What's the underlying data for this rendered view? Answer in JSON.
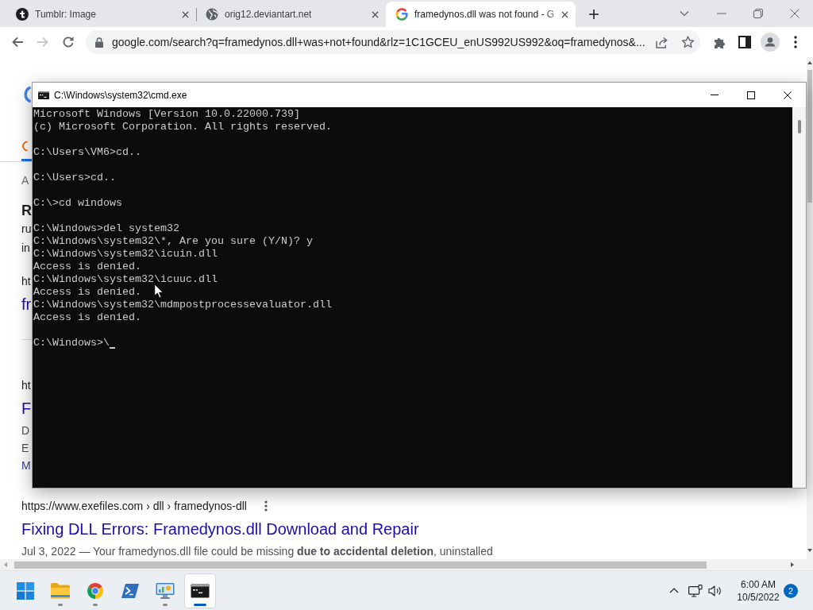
{
  "browser": {
    "tabs": [
      {
        "title": "Tumblr: Image",
        "selected": false
      },
      {
        "title": "orig12.deviantart.net",
        "selected": false
      },
      {
        "title": "framedynos.dll was not found - G",
        "selected": true
      }
    ],
    "nav_buttons": [
      {
        "disabled": false
      },
      {
        "disabled": true
      },
      {
        "disabled": false
      }
    ],
    "address_bar": {
      "url": "google.com/search?q=framedynos.dll+was+not+found&rlz=1C1GCEU_enUS992US992&oq=framedynos&..."
    }
  },
  "page": {
    "blocks": [
      {
        "kind": "stats",
        "text": "A"
      },
      {
        "kind": "related",
        "heading": "R",
        "items": [
          "ru",
          "in"
        ]
      },
      {
        "kind": "result",
        "url": "ht",
        "title": "fr"
      },
      {
        "kind": "divider"
      },
      {
        "kind": "result",
        "url": "ht",
        "title": "F",
        "lines": [
          {
            "kind": "text",
            "text": "D"
          },
          {
            "kind": "text",
            "text": "E"
          },
          {
            "kind": "link",
            "text": "M"
          }
        ]
      },
      {
        "kind": "result",
        "url": "https://www.exefiles.com › dll › framedynos-dll",
        "menu": true,
        "title": "Fixing DLL Errors: Framedynos.dll Download and Repair",
        "lines": [
          {
            "kind": "text",
            "text": "Jul 3, 2022 — Your framedynos.dll file could be missing **due to accidental deletion**, uninstalled"
          }
        ]
      }
    ]
  },
  "console_window": {
    "title": "C:\\Windows\\system32\\cmd.exe",
    "blocks": [
      [
        "Microsoft Windows [Version 10.0.22000.739]",
        "(c) Microsoft Corporation. All rights reserved."
      ],
      [
        "C:\\Users\\VM6>cd.."
      ],
      [
        "C:\\Users>cd.."
      ],
      [
        "C:\\>cd windows"
      ],
      [
        "C:\\Windows>del system32",
        "C:\\Windows\\system32\\*, Are you sure (Y/N)? y",
        "C:\\Windows\\system32\\icuin.dll",
        "Access is denied.",
        "C:\\Windows\\system32\\icuuc.dll",
        "Access is denied.",
        "C:\\Windows\\system32\\mdmpostprocessevaluator.dll",
        "Access is denied."
      ],
      [
        "C:\\Windows>\\"
      ]
    ]
  },
  "taskbar": {
    "apps": [
      {
        "running": false,
        "selected": false
      },
      {
        "running": true,
        "selected": false
      },
      {
        "running": true,
        "selected": false
      },
      {
        "running": false,
        "selected": false
      },
      {
        "running": true,
        "selected": false
      },
      {
        "running": true,
        "selected": true
      }
    ],
    "time": "6:00 AM",
    "date": "10/5/2022",
    "notification_count": "2"
  }
}
